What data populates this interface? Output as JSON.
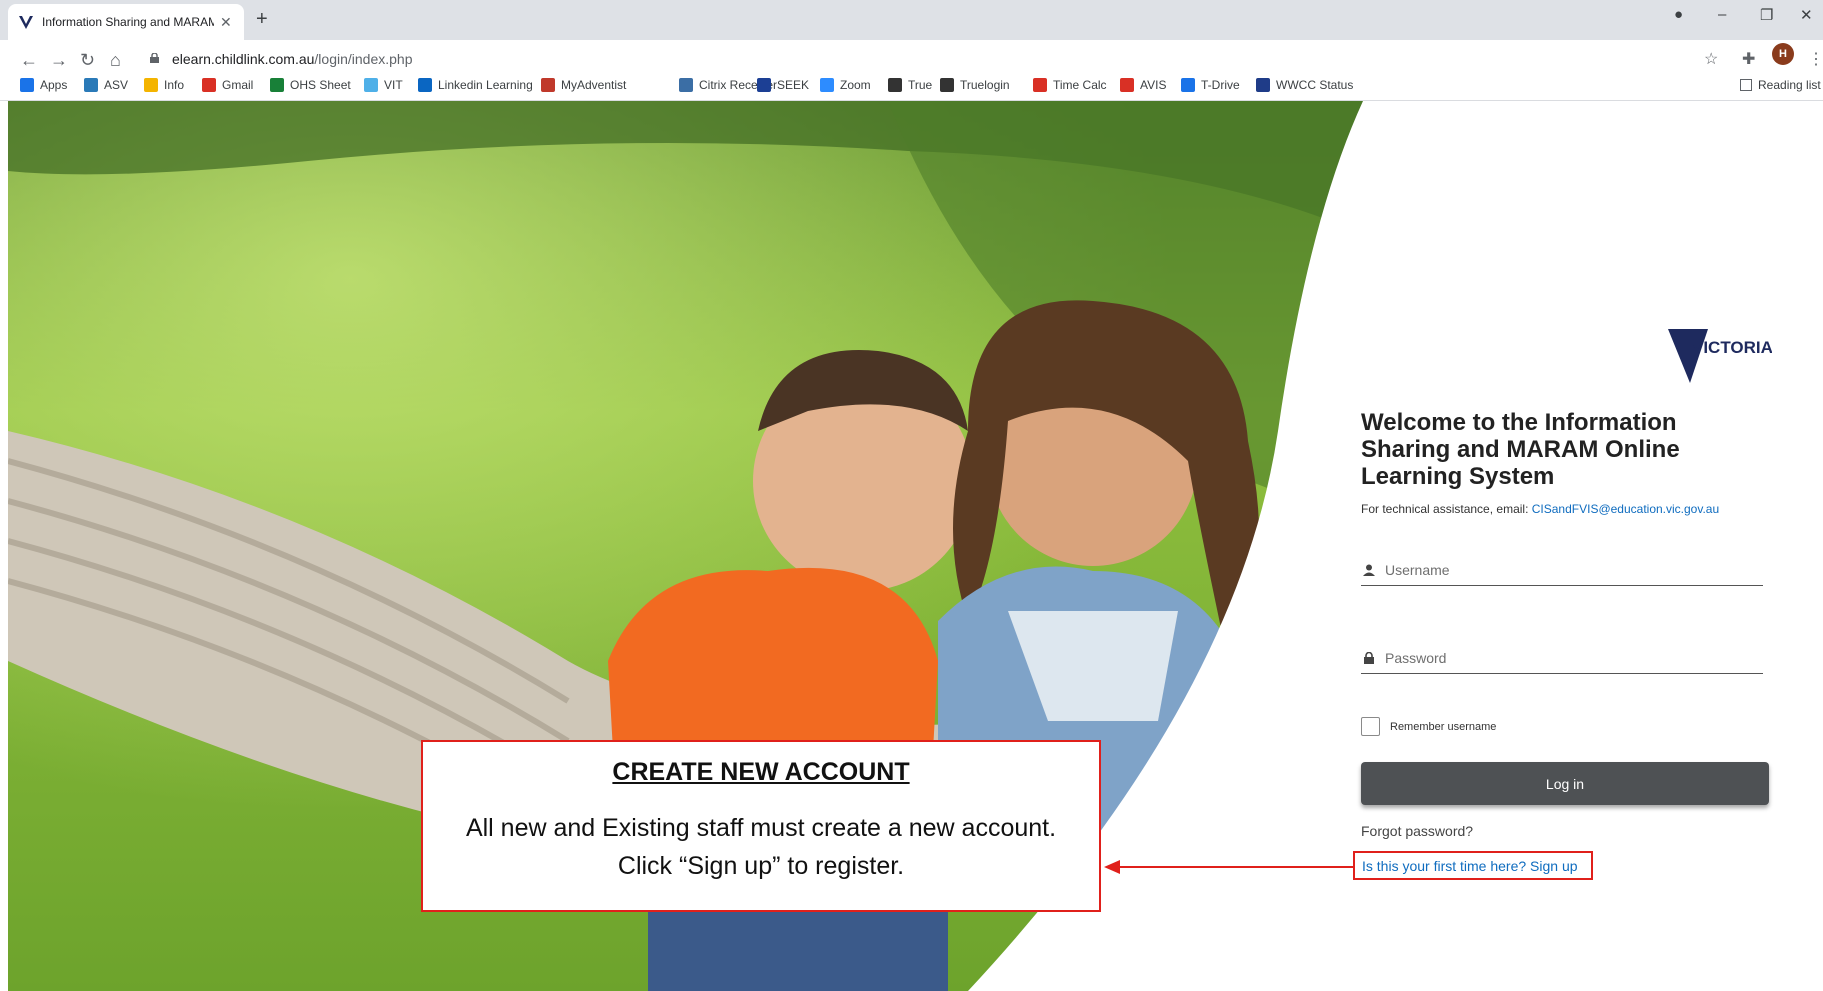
{
  "browser": {
    "tab_title": "Information Sharing and MARAM",
    "url_domain": "elearn.childlink.com.au",
    "url_path": "/login/index.php",
    "avatar_initial": "H",
    "bookmarks": [
      {
        "label": "Apps",
        "color": "#1a73e8"
      },
      {
        "label": "ASV",
        "color": "#2a7ab8"
      },
      {
        "label": "Info",
        "color": "#f4b400"
      },
      {
        "label": "Gmail",
        "color": "#d93025"
      },
      {
        "label": "OHS Sheet",
        "color": "#188038"
      },
      {
        "label": "VIT",
        "color": "#4fb0e8"
      },
      {
        "label": "Linkedin Learning",
        "color": "#0a66c2"
      },
      {
        "label": "MyAdventist",
        "color": "#c0392b"
      },
      {
        "label": "Citrix Receiver",
        "color": "#3b6ea5"
      },
      {
        "label": "SEEK",
        "color": "#1c3f94"
      },
      {
        "label": "Zoom",
        "color": "#2d8cff"
      },
      {
        "label": "True",
        "color": "#333333"
      },
      {
        "label": "Truelogin",
        "color": "#333333"
      },
      {
        "label": "Time Calc",
        "color": "#d93025"
      },
      {
        "label": "AVIS",
        "color": "#d93025"
      },
      {
        "label": "T-Drive",
        "color": "#1a73e8"
      },
      {
        "label": "WWCC Status",
        "color": "#1f3c88"
      }
    ],
    "reading_list": "Reading list"
  },
  "login": {
    "logo_text": "VICTORIA",
    "welcome": "Welcome to the Information Sharing and MARAM Online Learning System",
    "assist_prefix": "For technical assistance, email:",
    "assist_email": "CISandFVIS@education.vic.gov.au",
    "username_placeholder": "Username",
    "password_placeholder": "Password",
    "remember_label": "Remember username",
    "login_button": "Log in",
    "forgot": "Forgot password?",
    "signup": "Is this your first time here? Sign up"
  },
  "callout": {
    "title": "CREATE NEW ACCOUNT",
    "line1": "All new and Existing staff must create a new account.",
    "line2": "Click “Sign up” to register."
  },
  "colors": {
    "annotation_red": "#e0201b",
    "link_blue": "#0f6cbf",
    "button_dark": "#4e5154",
    "victoria_navy": "#1e2a5e"
  }
}
